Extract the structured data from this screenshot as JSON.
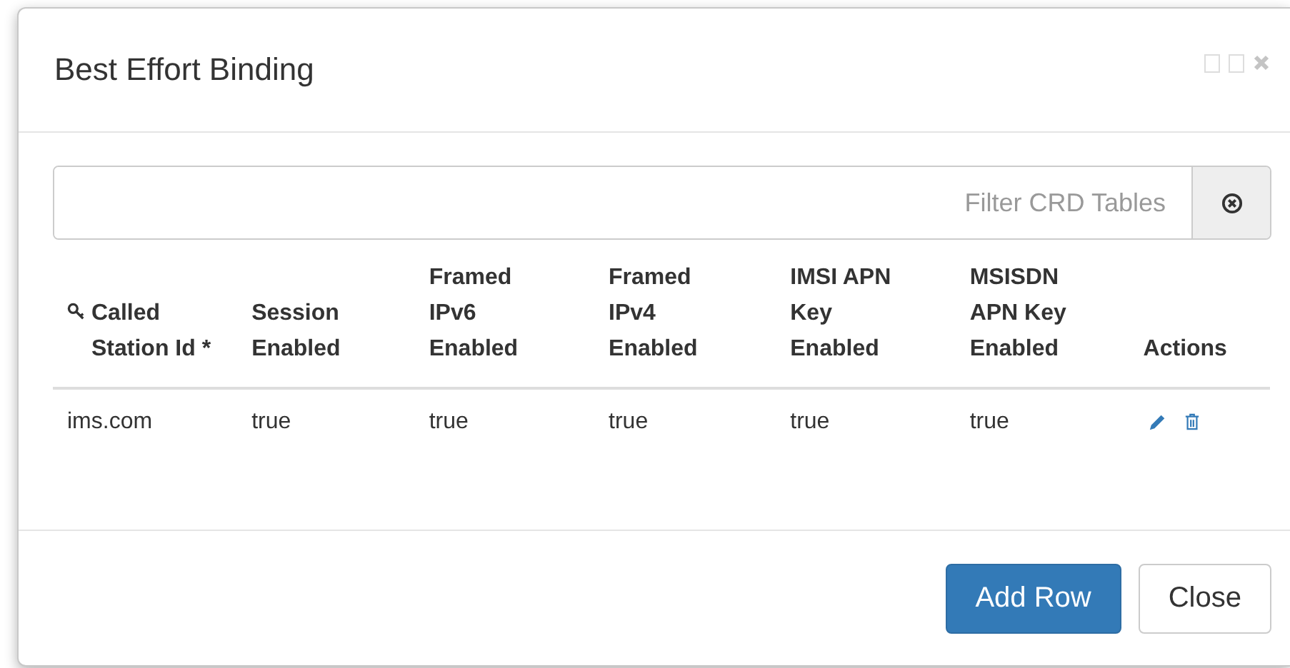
{
  "dialog": {
    "title": "Best Effort Binding"
  },
  "filter": {
    "placeholder": "Filter CRD Tables"
  },
  "table": {
    "columns": [
      {
        "label": "Called Station Id *",
        "key": true
      },
      {
        "label": "Session Enabled",
        "key": false
      },
      {
        "label": "Framed IPv6 Enabled",
        "key": false
      },
      {
        "label": "Framed IPv4 Enabled",
        "key": false
      },
      {
        "label": "IMSI APN Key Enabled",
        "key": false
      },
      {
        "label": "MSISDN APN Key Enabled",
        "key": false
      },
      {
        "label": "Actions",
        "key": false
      }
    ],
    "rows": [
      {
        "cells": [
          "ims.com",
          "true",
          "true",
          "true",
          "true",
          "true"
        ]
      }
    ]
  },
  "buttons": [
    {
      "label": "Add Row",
      "kind": "primary"
    },
    {
      "label": "Close",
      "kind": "default"
    }
  ]
}
